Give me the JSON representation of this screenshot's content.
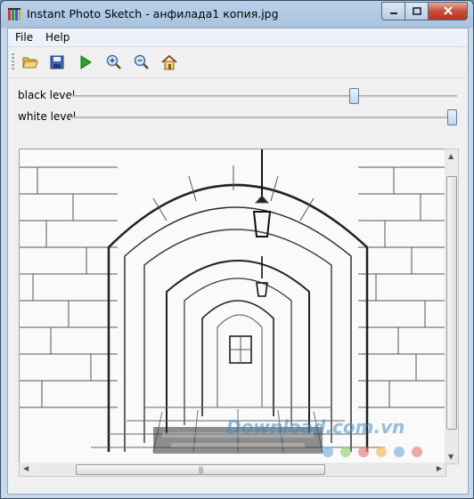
{
  "window": {
    "title": "Instant Photo Sketch - анфилада1 копия.jpg"
  },
  "menubar": {
    "items": [
      "File",
      "Help"
    ]
  },
  "toolbar": {
    "buttons": [
      {
        "name": "open-icon"
      },
      {
        "name": "save-icon"
      },
      {
        "name": "run-icon"
      },
      {
        "name": "zoom-in-icon"
      },
      {
        "name": "zoom-out-icon"
      },
      {
        "name": "home-icon"
      }
    ]
  },
  "sliders": {
    "black": {
      "label": "black level",
      "value": 0.74
    },
    "white": {
      "label": "white level",
      "value": 1.0
    }
  },
  "watermark": {
    "text": "Download.com.vn"
  },
  "colors": {
    "accent": "#4f86b8",
    "close": "#c74f3a"
  }
}
